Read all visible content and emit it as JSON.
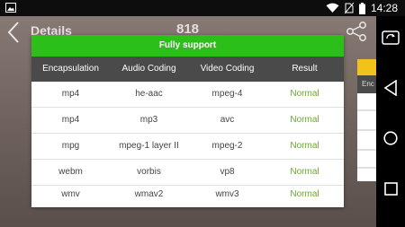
{
  "status_bar": {
    "time": "14:28"
  },
  "header": {
    "title": "Details",
    "count": "818"
  },
  "dialog": {
    "title": "Fully support",
    "columns": [
      "Encapsulation",
      "Audio Coding",
      "Video Coding",
      "Result"
    ],
    "rows": [
      [
        "mp4",
        "he-aac",
        "mpeg-4",
        "Normal"
      ],
      [
        "mp4",
        "mp3",
        "avc",
        "Normal"
      ],
      [
        "mpg",
        "mpeg-1 layer II",
        "mpeg-2",
        "Normal"
      ],
      [
        "webm",
        "vorbis",
        "vp8",
        "Normal"
      ],
      [
        "wmv",
        "wmav2",
        "wmv3",
        "Normal"
      ]
    ]
  },
  "behind_panel": {
    "header_fragment": "Enc"
  },
  "colors": {
    "accent_green": "#2cbf1a",
    "result_green": "#6aa82e",
    "header_gray": "#4a4a4a",
    "yellow": "#f0c21b"
  },
  "icons": [
    "image-icon",
    "wifi-icon",
    "sim-off-icon",
    "battery-icon",
    "back-icon",
    "share-icon",
    "rotate-screen-icon",
    "nav-back-icon",
    "nav-home-icon",
    "nav-recents-icon"
  ]
}
